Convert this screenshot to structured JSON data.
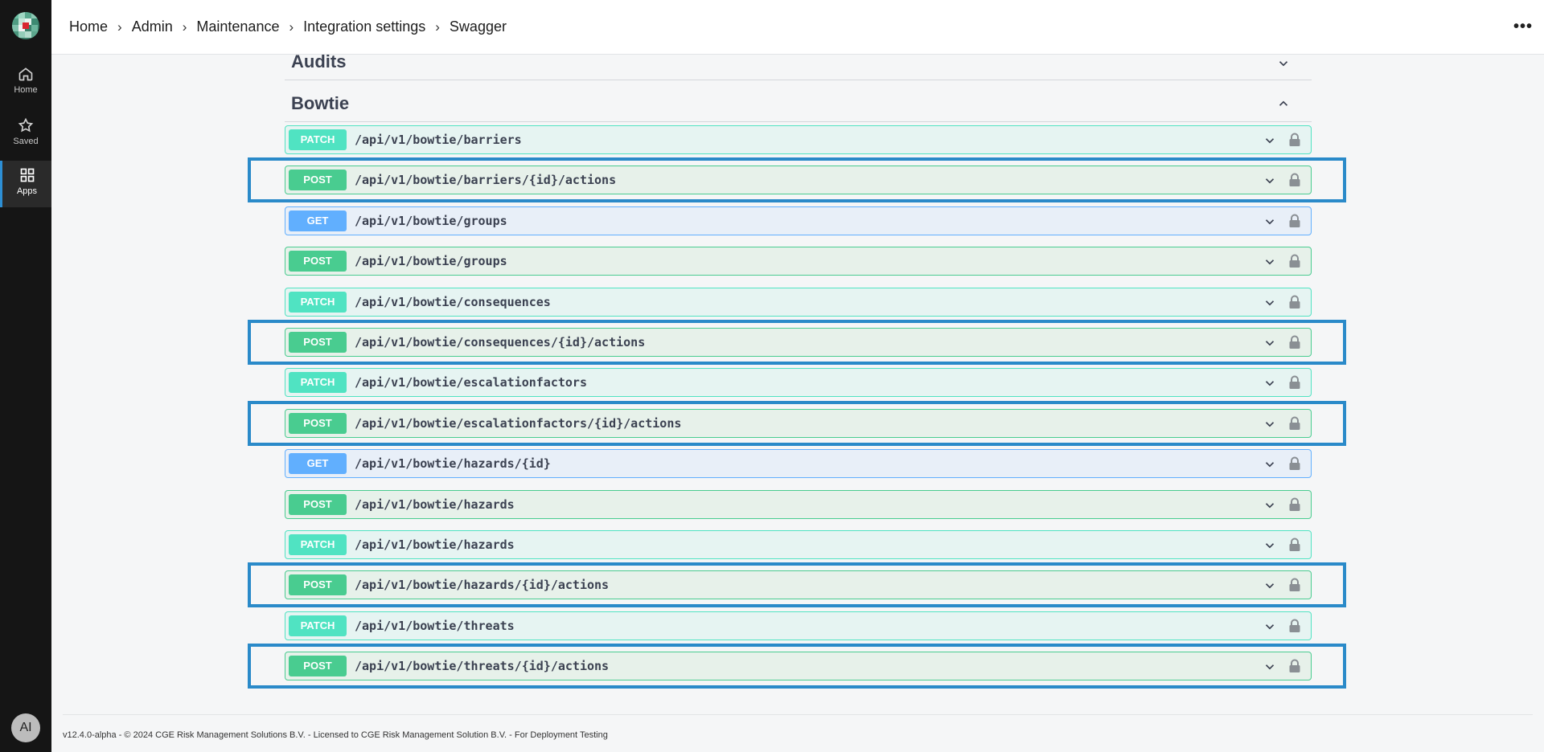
{
  "sidebar": {
    "items": [
      {
        "label": "Home",
        "icon": "home-icon"
      },
      {
        "label": "Saved",
        "icon": "star-icon"
      },
      {
        "label": "Apps",
        "icon": "apps-icon",
        "active": true
      }
    ],
    "avatar": "AI"
  },
  "header": {
    "breadcrumb": [
      "Home",
      "Admin",
      "Maintenance",
      "Integration settings",
      "Swagger"
    ],
    "more": "•••"
  },
  "sections": {
    "audits": "Audits",
    "bowtie": "Bowtie"
  },
  "operations": [
    {
      "method": "PATCH",
      "path": "/api/v1/bowtie/barriers",
      "highlighted": false
    },
    {
      "method": "POST",
      "path": "/api/v1/bowtie/barriers/{id}/actions",
      "highlighted": true
    },
    {
      "method": "GET",
      "path": "/api/v1/bowtie/groups",
      "highlighted": false
    },
    {
      "method": "POST",
      "path": "/api/v1/bowtie/groups",
      "highlighted": false
    },
    {
      "method": "PATCH",
      "path": "/api/v1/bowtie/consequences",
      "highlighted": false
    },
    {
      "method": "POST",
      "path": "/api/v1/bowtie/consequences/{id}/actions",
      "highlighted": true
    },
    {
      "method": "PATCH",
      "path": "/api/v1/bowtie/escalationfactors",
      "highlighted": false
    },
    {
      "method": "POST",
      "path": "/api/v1/bowtie/escalationfactors/{id}/actions",
      "highlighted": true
    },
    {
      "method": "GET",
      "path": "/api/v1/bowtie/hazards/{id}",
      "highlighted": false
    },
    {
      "method": "POST",
      "path": "/api/v1/bowtie/hazards",
      "highlighted": false
    },
    {
      "method": "PATCH",
      "path": "/api/v1/bowtie/hazards",
      "highlighted": false
    },
    {
      "method": "POST",
      "path": "/api/v1/bowtie/hazards/{id}/actions",
      "highlighted": true
    },
    {
      "method": "PATCH",
      "path": "/api/v1/bowtie/threats",
      "highlighted": false
    },
    {
      "method": "POST",
      "path": "/api/v1/bowtie/threats/{id}/actions",
      "highlighted": true
    }
  ],
  "colors": {
    "patch": "#50e3c2",
    "post": "#49cc90",
    "get": "#61affe",
    "highlight": "#2a8ac9"
  },
  "footer": "v12.4.0-alpha - © 2024 CGE Risk Management Solutions B.V. - Licensed to CGE Risk Management Solution B.V. - For Deployment Testing"
}
